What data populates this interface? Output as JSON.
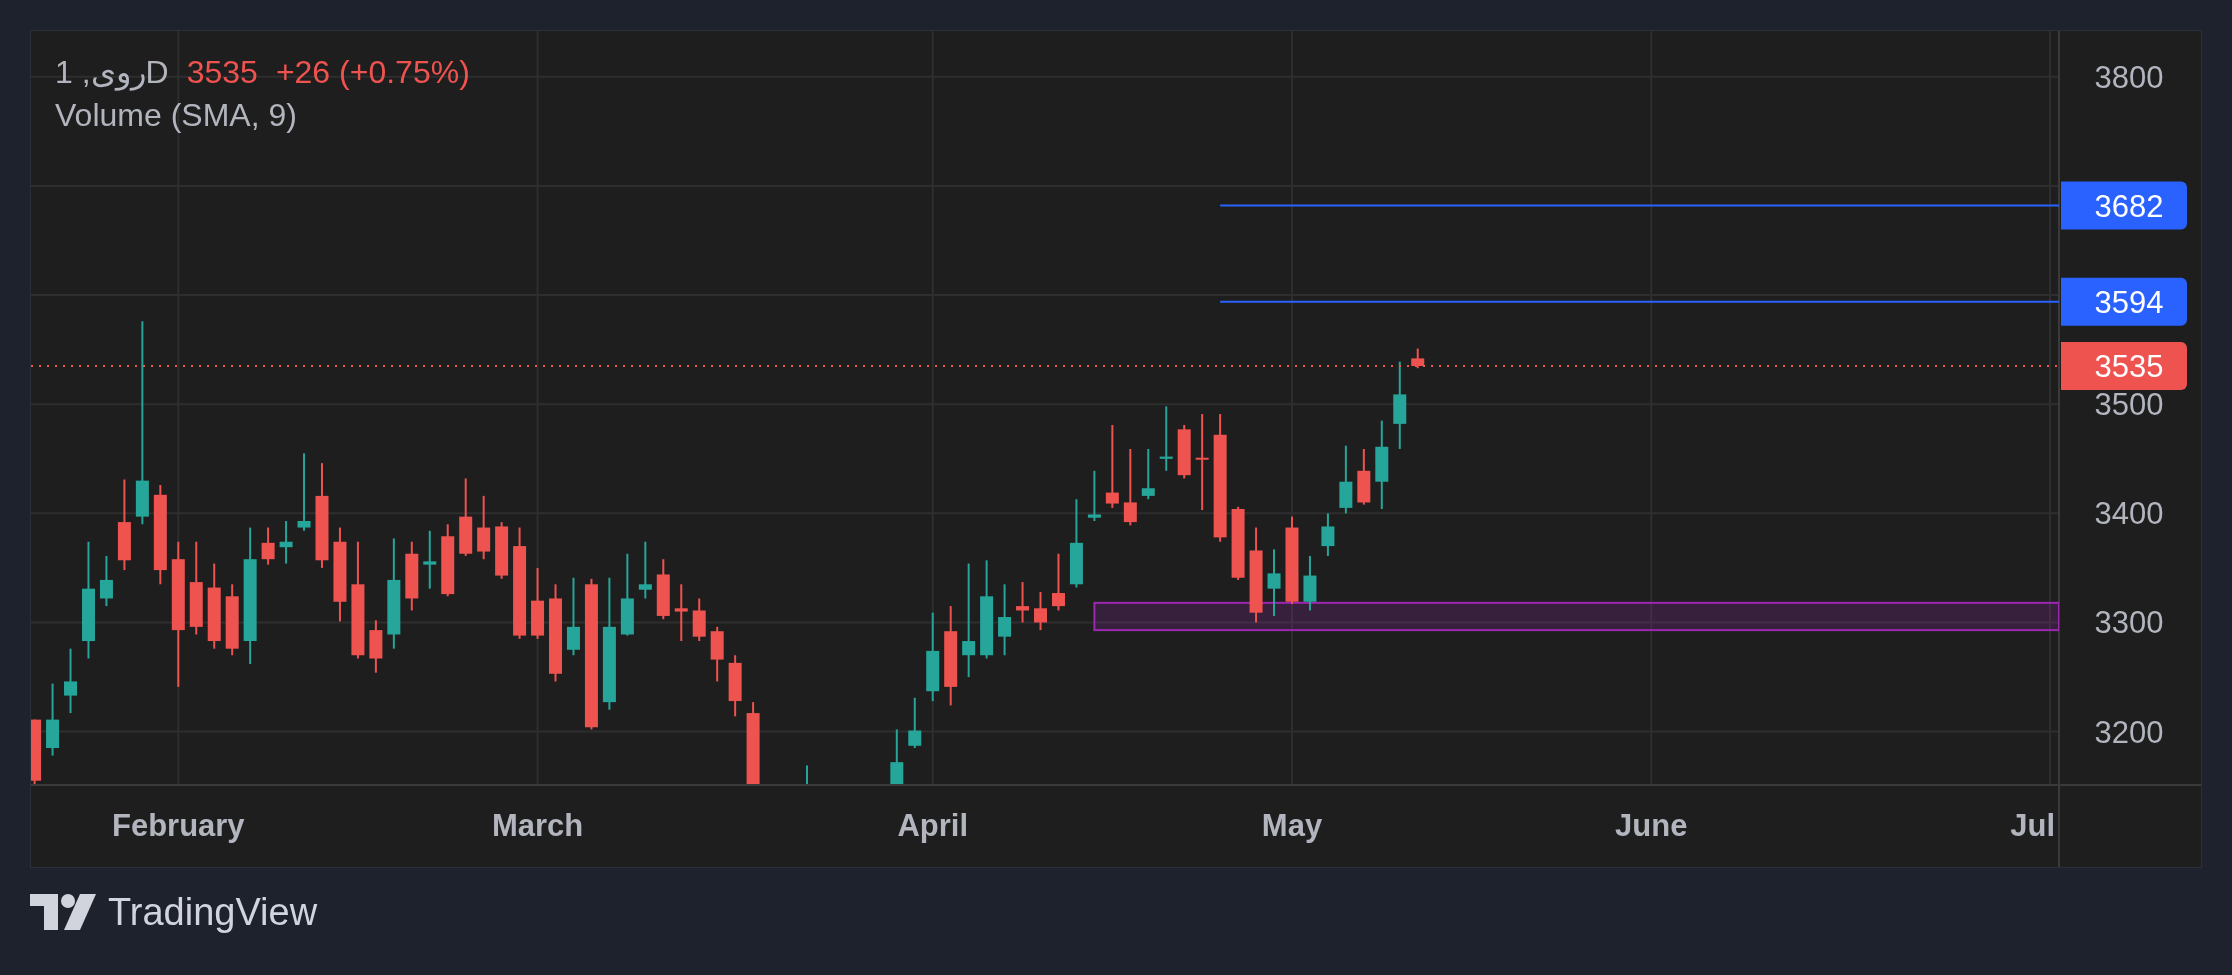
{
  "legend": {
    "symbol": "1 ,رویD",
    "price": "3535",
    "change": "+26 (+0.75%)",
    "indicator": "Volume (SMA, 9)"
  },
  "chart": {
    "price_axis_labels": [
      "3800",
      "3500",
      "3400",
      "3300",
      "3200"
    ],
    "time_axis_labels": [
      "February",
      "March",
      "April",
      "May",
      "June",
      "Jul"
    ],
    "price_badges": [
      {
        "label": "3682",
        "color": "#2962ff"
      },
      {
        "label": "3594",
        "color": "#2962ff"
      },
      {
        "label": "3535",
        "color": "#ef5350"
      }
    ]
  },
  "footer": {
    "brand": "TradingView"
  }
}
